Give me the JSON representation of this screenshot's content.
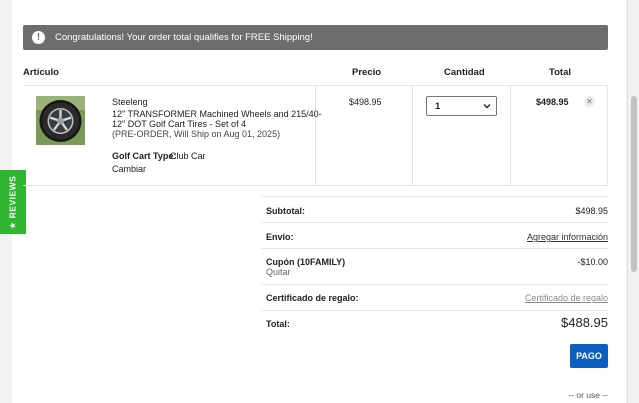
{
  "alert": {
    "icon": "exclamation-icon",
    "text": "Congratulations! Your order total qualifies for FREE Shipping!"
  },
  "reviews_tab": {
    "label": "★ REVIEWS"
  },
  "table": {
    "headers": {
      "item": "Artículo",
      "price": "Precio",
      "quantity": "Cantidad",
      "total": "Total"
    },
    "row": {
      "brand": "Steeleng",
      "name_line1": "12\" TRANSFORMER Machined Wheels and 215/40-",
      "name_line2": "12\" DOT Golf Cart Tires - Set of 4",
      "preorder": "(PRE-ORDER, Will Ship on Aug 01, 2025)",
      "option_label": "Golf Cart Type:",
      "option_value": "Club Car",
      "change_link": "Cambiar",
      "price": "$498.95",
      "quantity": "1",
      "total": "$498.95",
      "remove_icon": "close-icon"
    }
  },
  "summary": {
    "subtotal_label": "Subtotal:",
    "subtotal_value": "$498.95",
    "shipping_label": "Envío:",
    "shipping_link": "Agregar información",
    "coupon_label": "Cupón (10FAMILY)",
    "coupon_remove": "Quitar",
    "coupon_value": "-$10.00",
    "gift_label": "Certificado de regalo:",
    "gift_link": "Certificado de regalo",
    "total_label": "Total:",
    "total_value": "$488.95"
  },
  "checkout": {
    "pay_label": "PAGO",
    "or_use": "-- or use --"
  },
  "colors": {
    "accent": "#0b5fbf",
    "alert_bg": "#6d6d6d",
    "reviews": "#2fb52f"
  }
}
